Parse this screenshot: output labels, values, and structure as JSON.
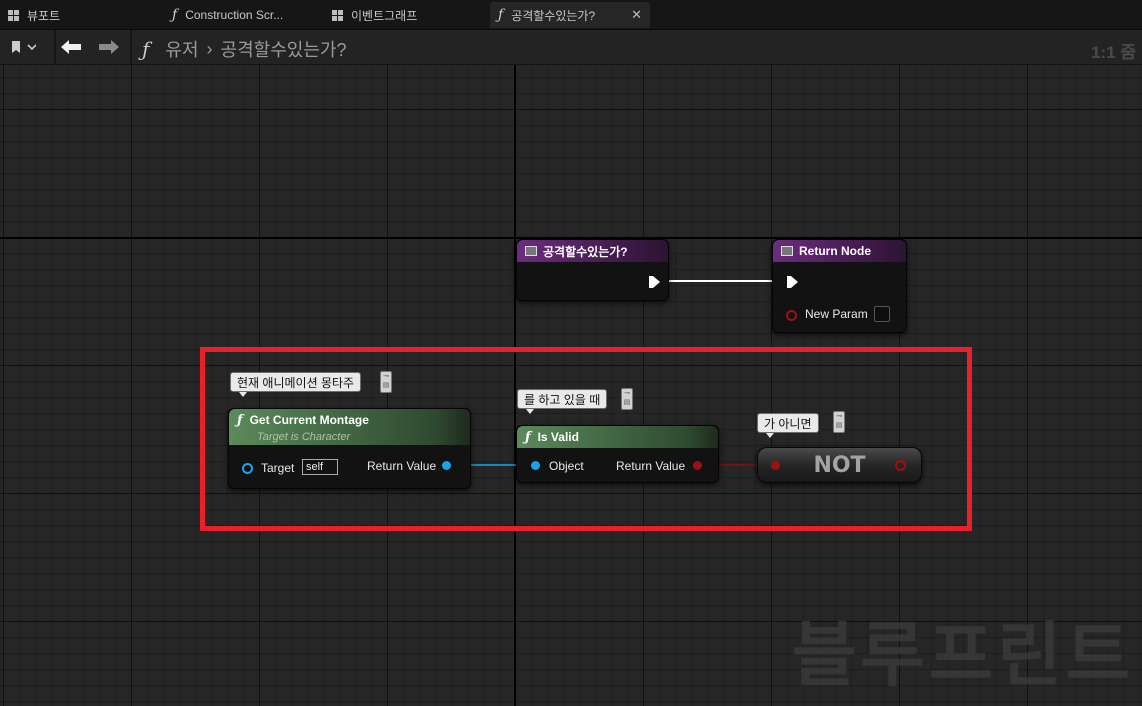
{
  "tabs": [
    {
      "label": "뷰포트",
      "icon": "viewport-grid-icon"
    },
    {
      "label": "Construction Scr...",
      "icon": "function-icon"
    },
    {
      "label": "이벤트그래프",
      "icon": "event-graph-icon"
    },
    {
      "label": "공격할수있는가?",
      "icon": "function-icon",
      "active": true,
      "close": "✕"
    }
  ],
  "toolbar": {
    "breadcrumb": [
      "유저",
      "공격할수있는가?"
    ],
    "breadcrumb_sep": "›",
    "zoom": "1:1 줌"
  },
  "nodes": {
    "entry": {
      "title": "공격할수있는가?"
    },
    "return": {
      "title": "Return Node",
      "param": "New Param"
    },
    "get_montage": {
      "title": "Get Current Montage",
      "subtitle": "Target is Character",
      "target_label": "Target",
      "target_value": "self",
      "return_label": "Return Value",
      "comment": "현재 애니메이션 몽타주"
    },
    "is_valid": {
      "title": "Is Valid",
      "input_label": "Object",
      "return_label": "Return Value",
      "comment": "를 하고 있을 때"
    },
    "not": {
      "label": "NOT",
      "comment": "가 아니면"
    }
  },
  "watermark": "블루프린트",
  "colors": {
    "exec": "#ffffff",
    "object_pin": "#1aa3e8",
    "bool_pin": "#8c0b0b",
    "highlight": "#e8202a",
    "pure_header": "#5b8a5b",
    "event_header": "#6d2c7e"
  }
}
